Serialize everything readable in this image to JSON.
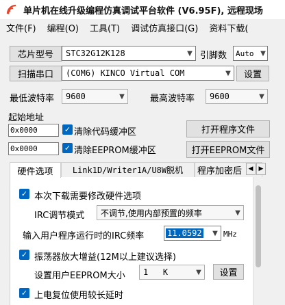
{
  "window": {
    "title": "单片机在线升级编程仿真调试平台软件 (V6.95F), 远程现场"
  },
  "menubar": {
    "items": [
      "文件(F)",
      "编程(O)",
      "工具(T)",
      "调试仿真接口(G)",
      "资料下载("
    ]
  },
  "chip": {
    "button_label": "芯片型号",
    "model": "STC32G12K128",
    "pins_label": "引脚数",
    "pins_value": "Auto"
  },
  "port": {
    "scan_button": "扫描串口",
    "selected": "(COM6) KINCO Virtual COM",
    "settings_button": "设置"
  },
  "baud": {
    "min_label": "最低波特率",
    "min_value": "9600",
    "max_label": "最高波特率",
    "max_value": "9600"
  },
  "address": {
    "start_label": "起始地址",
    "code_addr": "0x0000",
    "code_clear_label": "清除代码缓冲区",
    "open_program_button": "打开程序文件",
    "eeprom_addr": "0x0000",
    "eeprom_clear_label": "清除EEPROM缓冲区",
    "open_eeprom_button": "打开EEPROM文件"
  },
  "tabs": {
    "items": [
      "硬件选项",
      "Link1D/Writer1A/U8W脱机",
      "程序加密后"
    ],
    "active": 0
  },
  "hw": {
    "modify_label": "本次下载需要修改硬件选项",
    "irc_mode_label": "IRC调节模式",
    "irc_mode_value": "不调节,使用内部预置的频率",
    "irc_freq_label": "输入用户程序运行时的IRC频率",
    "irc_freq_value": "11.0592",
    "irc_freq_unit": "MHz",
    "osc_gain_label": "振荡器放大增益(12M以上建议选择)",
    "eeprom_size_label": "设置用户EEPROM大小",
    "eeprom_size_value": "1   K",
    "eeprom_settings_button": "设置",
    "long_reset_label": "上电复位使用较长延时"
  },
  "colors": {
    "accent": "#0067c0",
    "title_icon": "#e8442c"
  }
}
